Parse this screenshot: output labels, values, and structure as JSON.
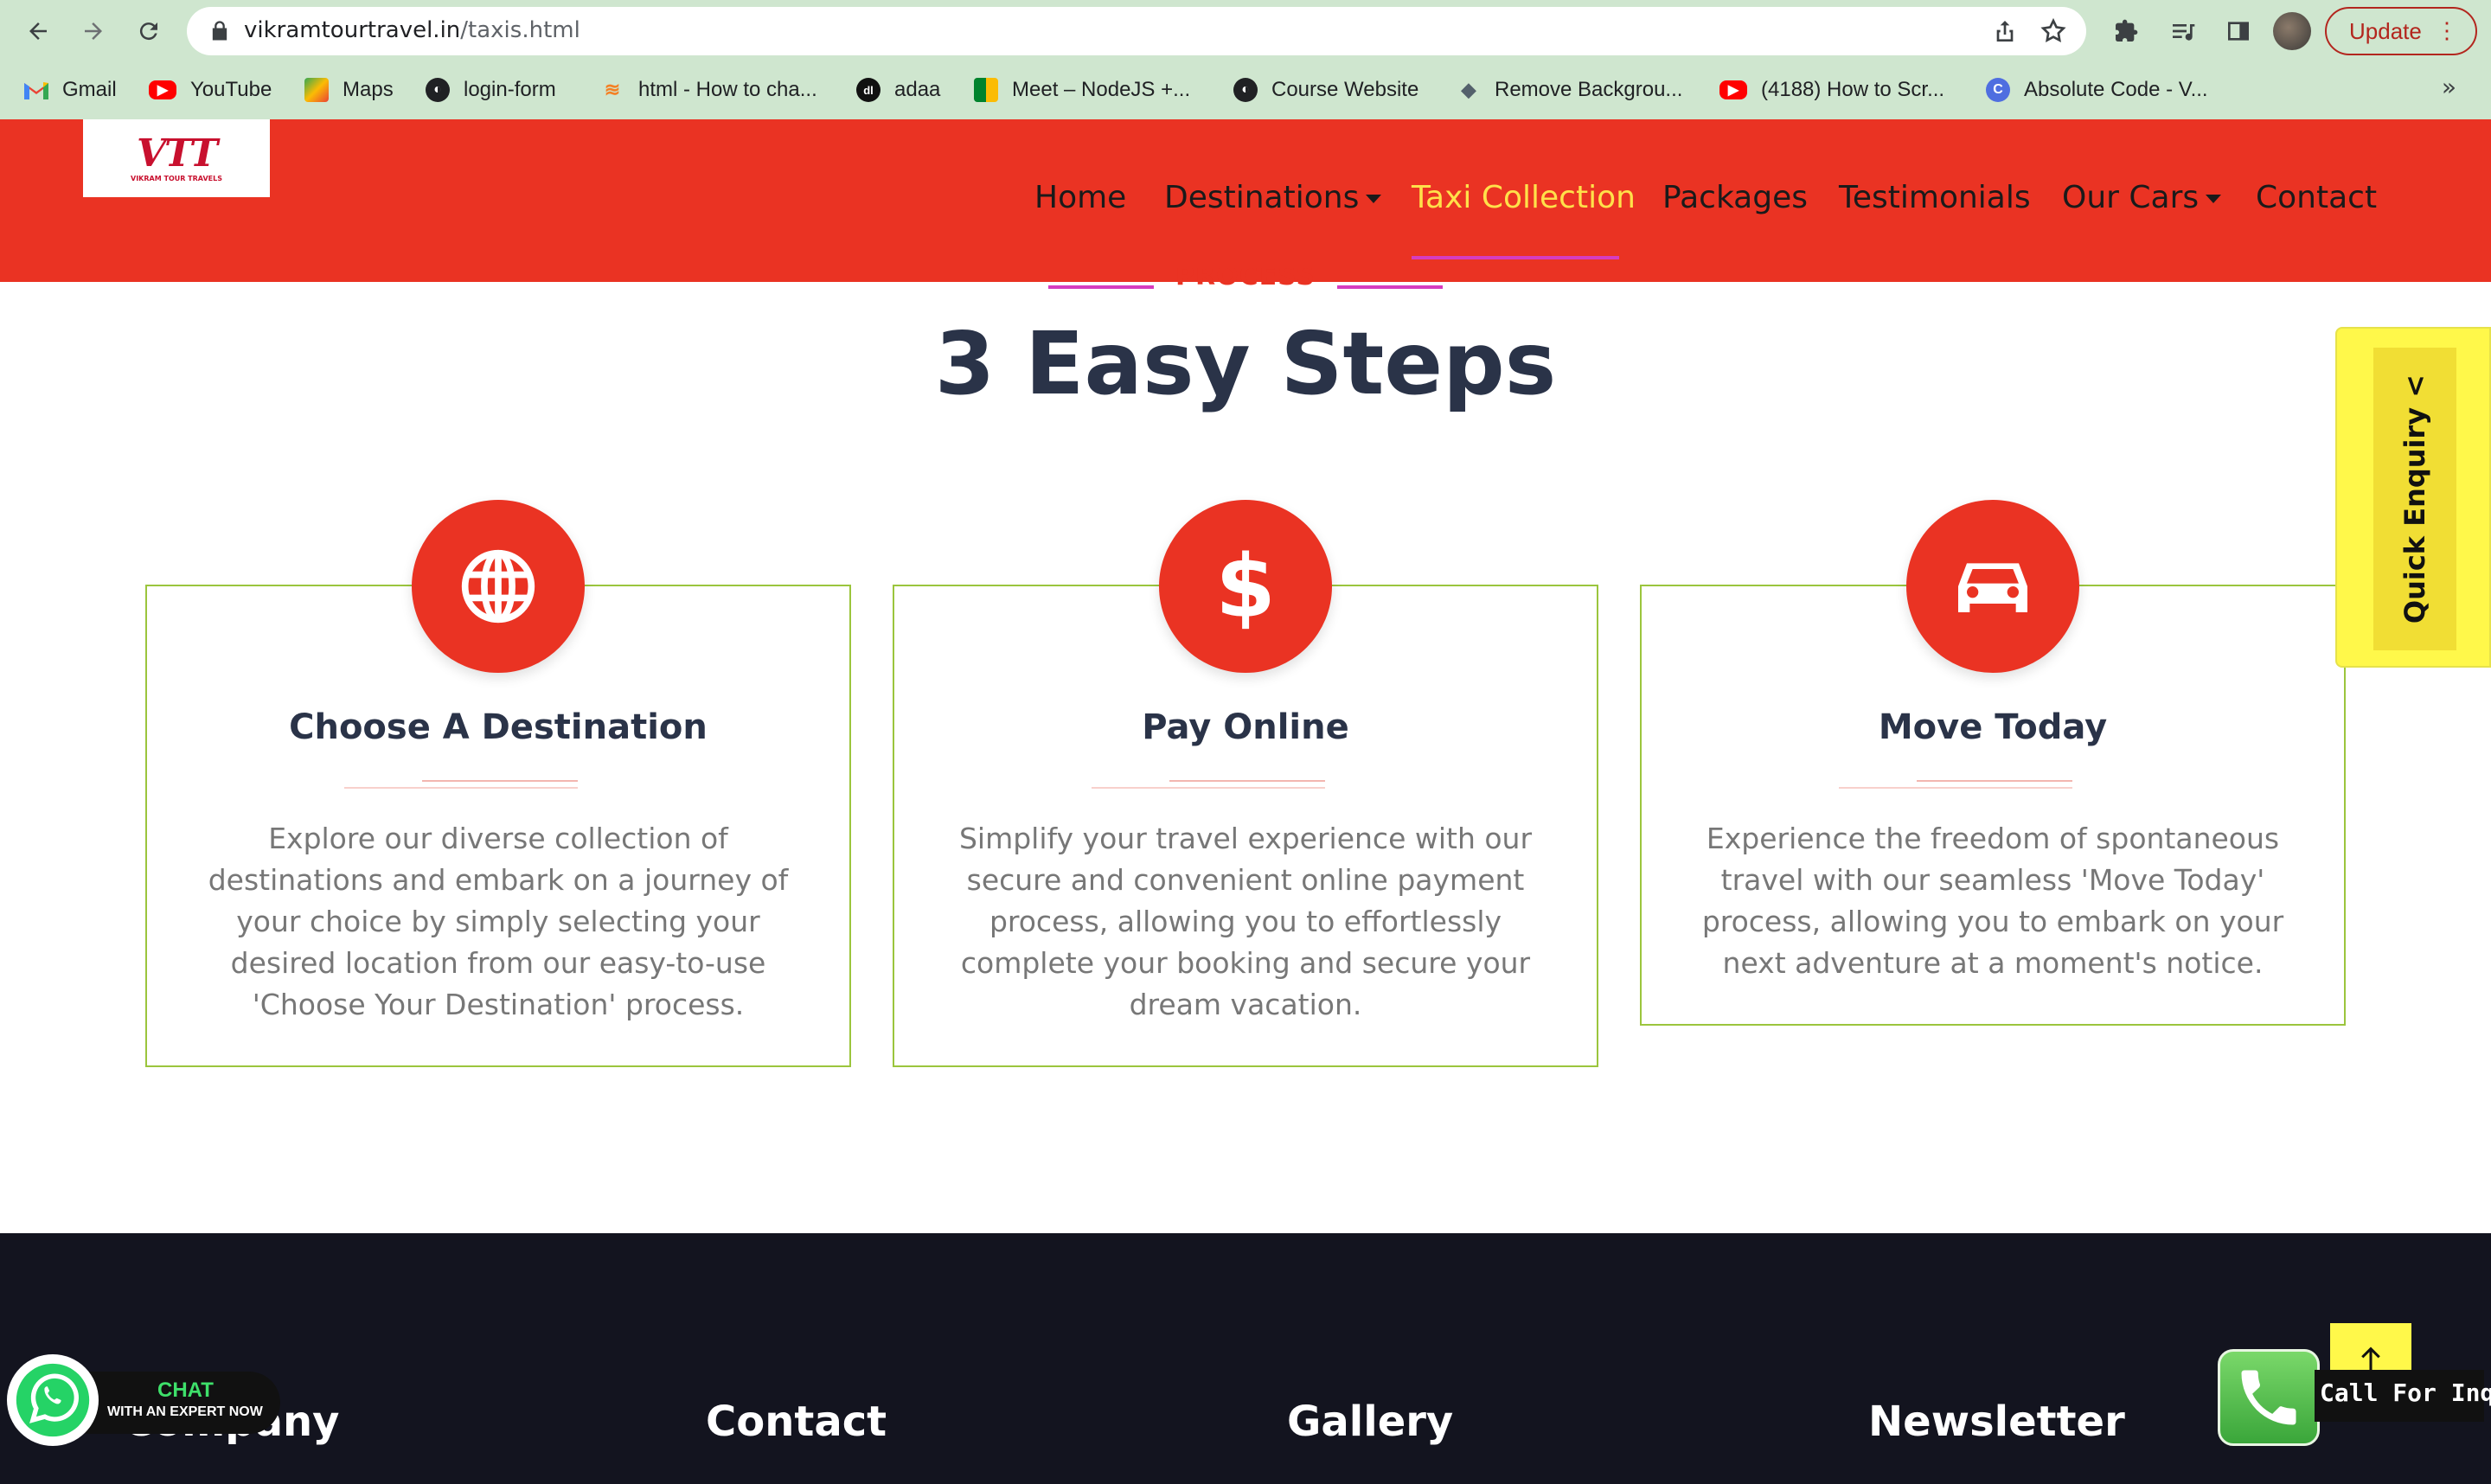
{
  "browser": {
    "url_host": "vikramtourtravel.in",
    "url_path": "/taxis.html",
    "update_label": "Update",
    "bookmarks": [
      {
        "label": "Gmail",
        "icon": "gmail-icon"
      },
      {
        "label": "YouTube",
        "icon": "youtube-icon"
      },
      {
        "label": "Maps",
        "icon": "maps-icon"
      },
      {
        "label": "login-form",
        "icon": "globe-icon"
      },
      {
        "label": "html - How to cha...",
        "icon": "stackoverflow-icon"
      },
      {
        "label": "adaa",
        "icon": "adaa-icon"
      },
      {
        "label": "Meet – NodeJS +...",
        "icon": "meet-icon"
      },
      {
        "label": "Course Website",
        "icon": "globe-icon"
      },
      {
        "label": "Remove Backgrou...",
        "icon": "removebg-icon"
      },
      {
        "label": "(4188) How to Scr...",
        "icon": "youtube-icon"
      },
      {
        "label": "Absolute Code - V...",
        "icon": "absolutecode-icon"
      }
    ],
    "more_label": "»"
  },
  "site": {
    "logo_mark": "VTT",
    "logo_sub": "VIKRAM TOUR TRAVELS",
    "nav": [
      {
        "label": "Home"
      },
      {
        "label": "Destinations"
      },
      {
        "label": "Taxi Collection"
      },
      {
        "label": "Packages"
      },
      {
        "label": "Testimonials"
      },
      {
        "label": "Our Cars"
      },
      {
        "label": "Contact"
      }
    ],
    "active_nav": "Taxi Collection"
  },
  "process": {
    "eyebrow": "PROCESS",
    "title": "3 Easy Steps",
    "steps": [
      {
        "icon": "globe-icon",
        "title": "Choose A Destination",
        "text": "Explore our diverse collection of destinations and embark on a journey of your choice by simply selecting your desired location from our easy-to-use 'Choose Your Destination' process."
      },
      {
        "icon": "dollar-icon",
        "title": "Pay Online",
        "text": "Simplify your travel experience with our secure and convenient online payment process, allowing you to effortlessly complete your booking and secure your dream vacation."
      },
      {
        "icon": "car-icon",
        "title": "Move Today",
        "text": "Experience the freedom of spontaneous travel with our seamless 'Move Today' process, allowing you to embark on your next adventure at a moment's notice."
      }
    ]
  },
  "quick_enquiry": {
    "label": "Quick Enquiry",
    "arrow": "<"
  },
  "footer": {
    "headings": [
      "Company",
      "Contact",
      "Gallery",
      "Newsletter"
    ]
  },
  "widgets": {
    "chat_line1": "CHAT",
    "chat_line2": "WITH AN EXPERT NOW",
    "call_label": "Call For Inquiry"
  },
  "colors": {
    "brand_red": "#ea3323",
    "active_nav": "#ffe14a",
    "card_border": "#9bc53d",
    "title_dark": "#2a3348",
    "quick_yellow": "#fff84a",
    "footer_bg": "#13141f"
  }
}
